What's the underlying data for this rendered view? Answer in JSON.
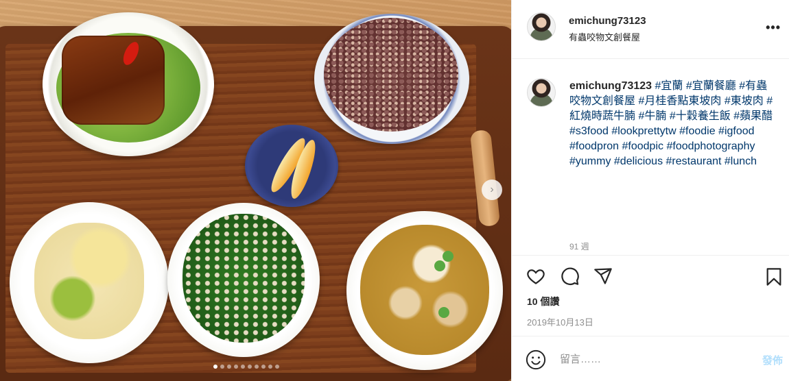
{
  "post": {
    "username": "emichung73123",
    "location": "有蟲咬物文創餐屋",
    "more_icon": "more-horizontal-icon"
  },
  "caption": {
    "username": "emichung73123",
    "hashtags": [
      "#宜蘭",
      "#宜蘭餐廳",
      "#有蟲咬物文創餐屋",
      "#月桂香點東坡肉",
      "#東坡肉",
      "#紅燒時蔬牛腩",
      "#牛腩",
      "#十穀養生飯",
      "#蘋果醋",
      "#s3food",
      "#lookprettytw",
      "#foodie",
      "#igfood",
      "#foodpron",
      "#foodpic",
      "#foodphotography",
      "#yummy",
      "#delicious",
      "#restaurant",
      "#lunch"
    ],
    "time_ago": "91 週"
  },
  "actions": {
    "icons": [
      "heart-icon",
      "comment-icon",
      "share-icon",
      "bookmark-icon"
    ]
  },
  "likes": "10 個讚",
  "date": "2019年10月13日",
  "comment": {
    "placeholder": "留言……",
    "post_label": "發佈",
    "emoji_icon": "emoji-icon"
  },
  "carousel": {
    "slide_count": 10,
    "active_index": 0
  },
  "colors": {
    "link": "#00376b",
    "post_button_disabled": "#b2dffc",
    "text": "#262626",
    "muted": "#8e8e8e"
  }
}
